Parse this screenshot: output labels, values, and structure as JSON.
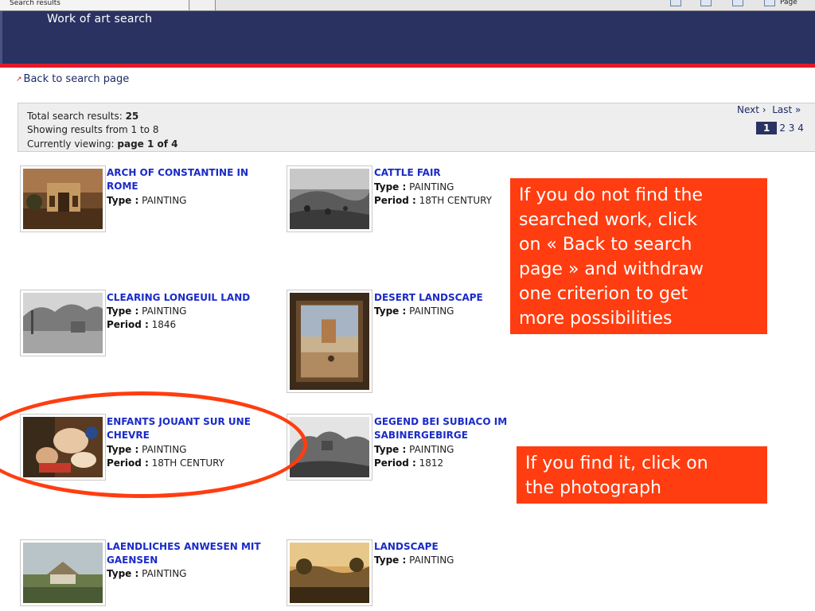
{
  "browser": {
    "tab_label": "Search results",
    "toolbar_label": "Page"
  },
  "header": {
    "title": "Work of art search"
  },
  "back_link": "Back to search page",
  "results": {
    "total_label": "Total search results: ",
    "total_value": "25",
    "showing": "Showing results from 1 to 8",
    "viewing_label": "Currently viewing: ",
    "viewing_value": "page 1 of 4"
  },
  "pager": {
    "next": "Next ›",
    "last": "Last »",
    "current_page": "1",
    "other_pages": "2 3 4"
  },
  "labels": {
    "type": "Type :",
    "period": "Period :"
  },
  "items": [
    {
      "title_line1": "ARCH OF CONSTANTINE IN",
      "title_line2": "ROME",
      "type": "PAINTING",
      "period": ""
    },
    {
      "title_line1": "CATTLE FAIR",
      "title_line2": "",
      "type": "PAINTING",
      "period": "18TH CENTURY"
    },
    {
      "title_line1": "CLEARING LONGEUIL LAND",
      "title_line2": "",
      "type": "PAINTING",
      "period": "1846"
    },
    {
      "title_line1": "DESERT LANDSCAPE",
      "title_line2": "",
      "type": "PAINTING",
      "period": ""
    },
    {
      "title_line1": "ENFANTS JOUANT SUR UNE",
      "title_line2": "CHEVRE",
      "type": "PAINTING",
      "period": "18TH CENTURY"
    },
    {
      "title_line1": "GEGEND BEI SUBIACO IM",
      "title_line2": "SABINERGEBIRGE",
      "type": "PAINTING",
      "period": "1812"
    },
    {
      "title_line1": "LAENDLICHES ANWESEN MIT",
      "title_line2": "GAENSEN",
      "type": "PAINTING",
      "period": ""
    },
    {
      "title_line1": "LANDSCAPE",
      "title_line2": "",
      "type": "PAINTING",
      "period": ""
    }
  ],
  "callouts": {
    "first_lines": [
      "If you do not find the",
      "searched work, click",
      "on « Back to search",
      "page » and withdraw",
      "one criterion to get",
      "more possibilities"
    ],
    "second_lines": [
      "If you find it, click on",
      "the photograph"
    ]
  },
  "colors": {
    "header_bg": "#2a3262",
    "accent_red": "#e2182a",
    "link_blue": "#1a2bc8",
    "callout_bg": "#ff3d10"
  }
}
